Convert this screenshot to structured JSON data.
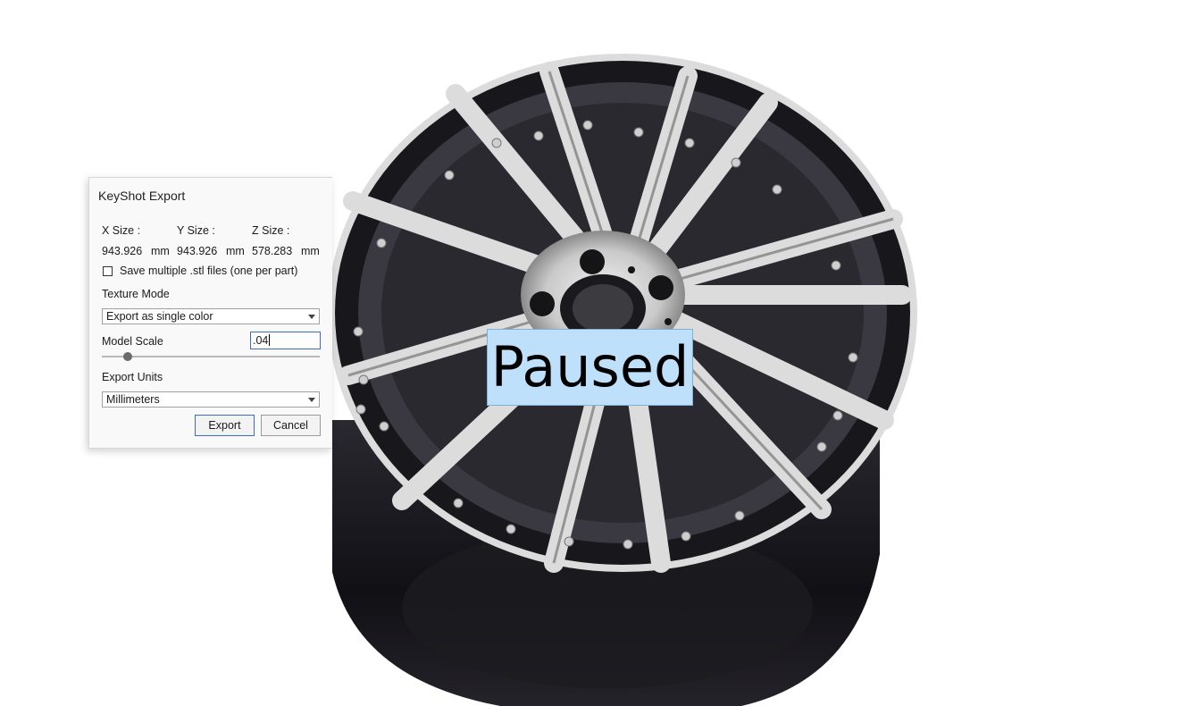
{
  "dialog": {
    "title": "KeyShot Export",
    "sizes": {
      "x_label": "X Size :",
      "y_label": "Y Size :",
      "z_label": "Z Size :",
      "x_value": "943.926",
      "y_value": "943.926",
      "z_value": "578.283",
      "unit": "mm"
    },
    "save_multiple_label": "Save multiple .stl files (one per part)",
    "save_multiple_checked": false,
    "texture_mode_label": "Texture Mode",
    "texture_mode_value": "Export as single color",
    "model_scale_label": "Model Scale",
    "model_scale_value": ".04",
    "model_scale_slider_fraction": 0.12,
    "export_units_label": "Export Units",
    "export_units_value": "Millimeters",
    "export_button": "Export",
    "cancel_button": "Cancel"
  },
  "overlay": {
    "paused_text": "Paused"
  },
  "colors": {
    "accent_border": "#3c6dbf",
    "paused_bg": "#bfe0fb",
    "wheel_dark": "#1b1a1f",
    "wheel_spoke": "#d9d9d9"
  }
}
